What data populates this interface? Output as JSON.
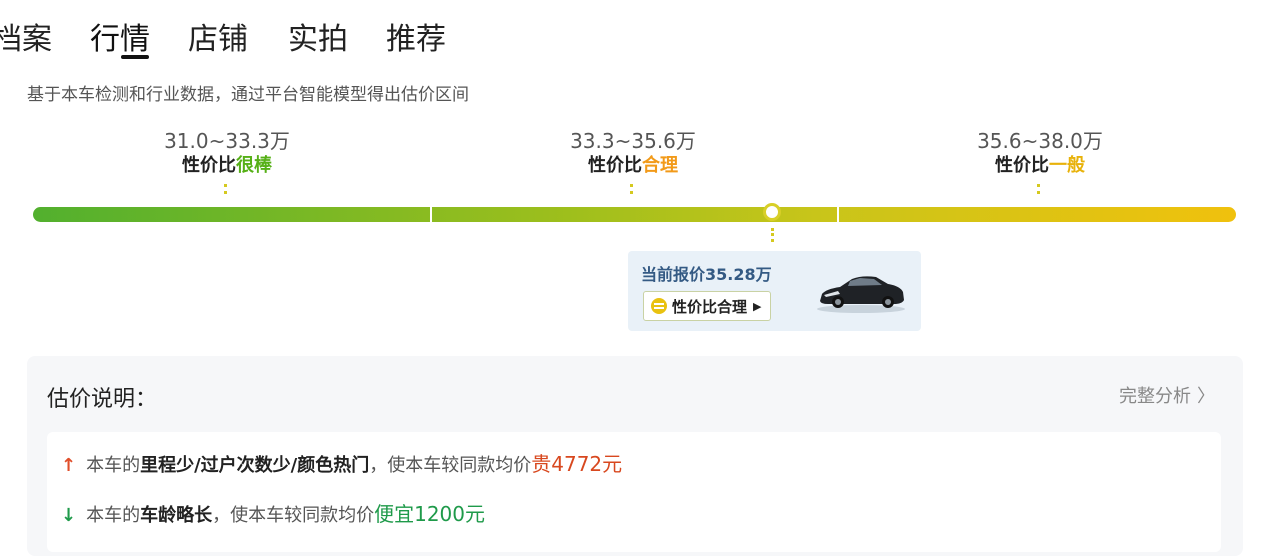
{
  "tabs": [
    {
      "label": "档案"
    },
    {
      "label": "行情"
    },
    {
      "label": "店铺"
    },
    {
      "label": "实拍"
    },
    {
      "label": "推荐"
    }
  ],
  "description": "基于本车检测和行业数据，通过平台智能模型得出估价区间",
  "ranges": [
    {
      "price": "31.0~33.3万",
      "label_prefix": "性价比",
      "label_highlight": "很棒",
      "color": "#56b017"
    },
    {
      "price": "33.3~35.6万",
      "label_prefix": "性价比",
      "label_highlight": "合理",
      "color": "#f29a19"
    },
    {
      "price": "35.6~38.0万",
      "label_prefix": "性价比",
      "label_highlight": "一般",
      "color": "#e8b20a"
    }
  ],
  "current_quote": {
    "text": "当前报价35.28万",
    "badge": "性价比合理",
    "badge_icon": "smile-icon",
    "arrow": "▶",
    "image": "car-photo"
  },
  "panel": {
    "title": "估价说明：",
    "link": "完整分析",
    "link_chevron": "〉",
    "reasons": [
      {
        "direction": "up",
        "arrow": "↑",
        "prefix": "本车的",
        "factors": "里程少/过户次数少/颜色热门",
        "middle": "，使本车较同款均价",
        "result": "贵4772元",
        "color": "#d8481f"
      },
      {
        "direction": "down",
        "arrow": "↓",
        "prefix": "本车的",
        "factors": "车龄略长",
        "middle": "，使本车较同款均价",
        "result": "便宜1200元",
        "color": "#1f9a4a"
      }
    ]
  },
  "colors": {
    "bar_start": "#52b02e",
    "bar_end": "#f0c10d",
    "quote_bg": "#e9f1f8",
    "quote_text": "#345a84"
  }
}
